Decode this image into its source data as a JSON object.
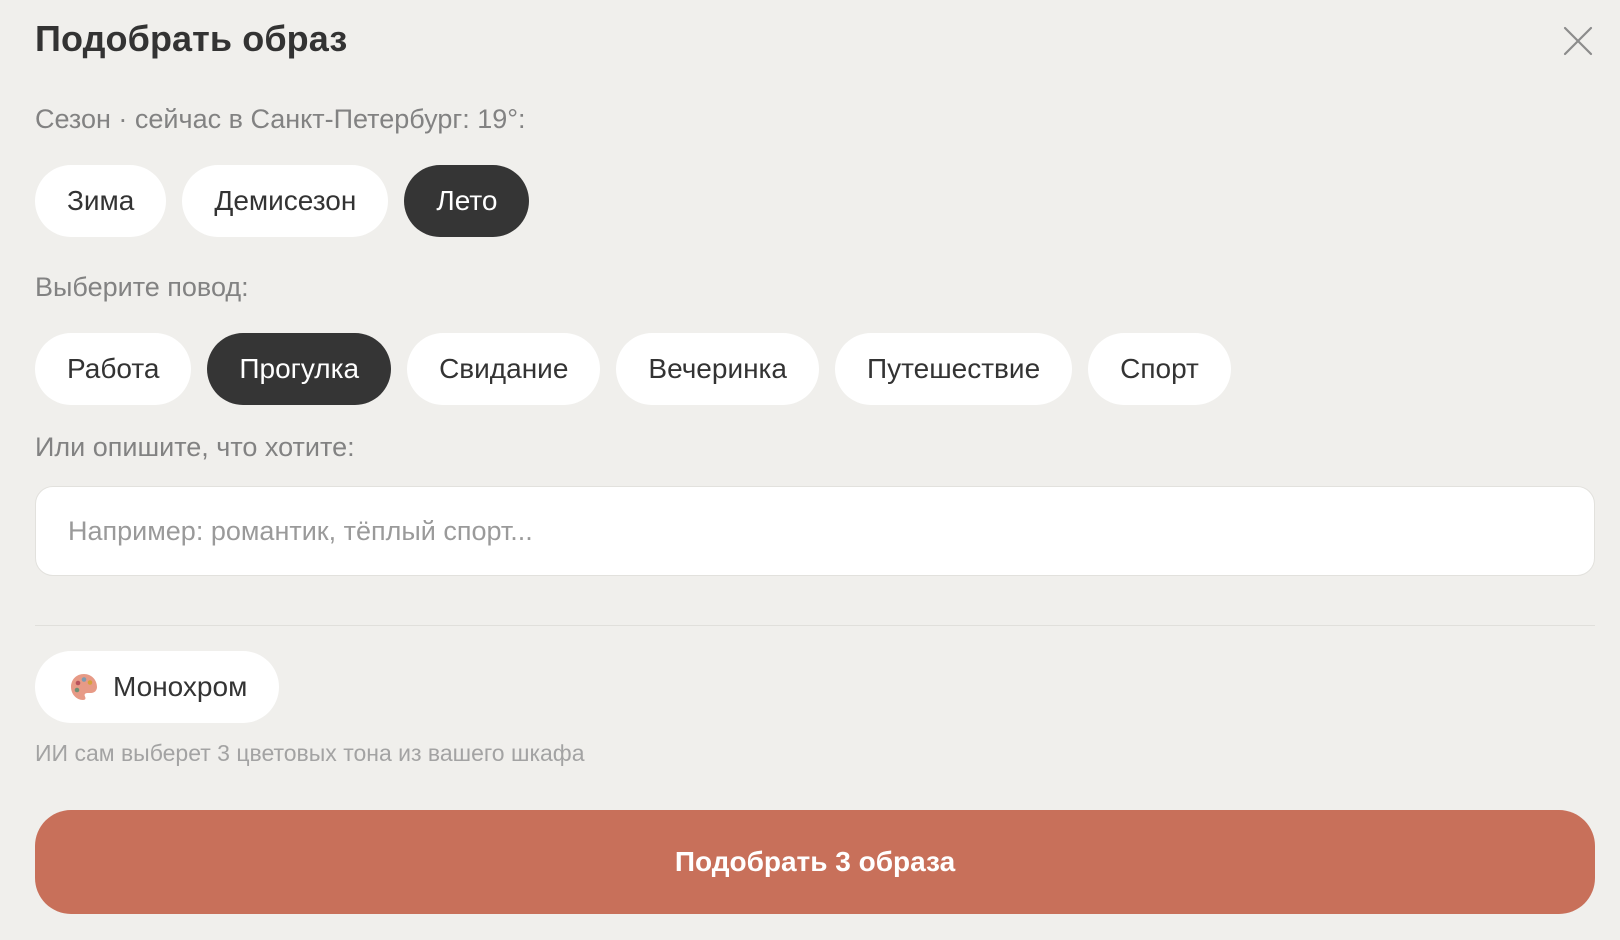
{
  "modal": {
    "title": "Подобрать образ",
    "close_icon": "close-icon"
  },
  "season": {
    "label": "Сезон · сейчас в Санкт-Петербург: 19°:",
    "options": [
      "Зима",
      "Демисезон",
      "Лето"
    ],
    "selected": "Лето"
  },
  "occasion": {
    "label": "Выберите повод:",
    "options": [
      "Работа",
      "Прогулка",
      "Свидание",
      "Вечеринка",
      "Путешествие",
      "Спорт"
    ],
    "selected": "Прогулка"
  },
  "describe": {
    "label": "Или опишите, что хотите:",
    "value": "",
    "placeholder": "Например: романтик, тёплый спорт..."
  },
  "monochrome": {
    "label": "Монохром",
    "icon": "palette-icon",
    "hint": "ИИ сам выберет 3 цветовых тона из вашего шкафа"
  },
  "submit": {
    "label": "Подобрать 3 образа"
  },
  "colors": {
    "background": "#f0efec",
    "chip": "#ffffff",
    "chip_active": "#353535",
    "accent": "#c8705a",
    "text": "#333333",
    "muted": "#828282"
  }
}
